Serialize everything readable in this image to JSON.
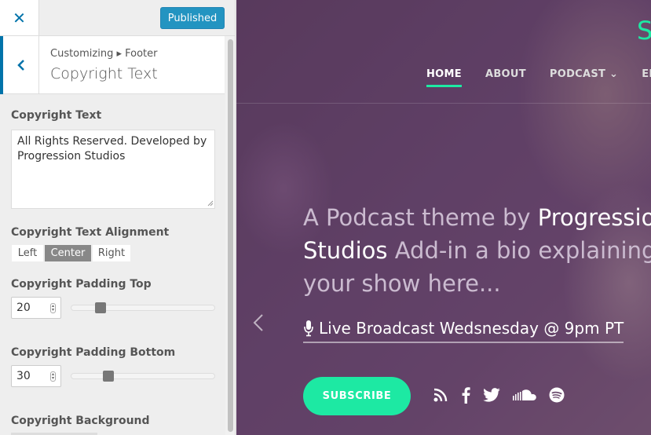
{
  "sidebar": {
    "close_label": "✕",
    "publish_label": "Published",
    "breadcrumb": "Customizing ▸ Footer",
    "section_title": "Copyright Text",
    "controls": {
      "copyright_text": {
        "label": "Copyright Text",
        "value": "All Rights Reserved. Developed by Progression Studios"
      },
      "alignment": {
        "label": "Copyright Text Alignment",
        "options": [
          "Left",
          "Center",
          "Right"
        ],
        "selected": "Center"
      },
      "padding_top": {
        "label": "Copyright Padding Top",
        "value": "20",
        "slider_fraction": 0.18
      },
      "padding_bottom": {
        "label": "Copyright Padding Bottom",
        "value": "30",
        "slider_fraction": 0.24
      },
      "background": {
        "label": "Copyright Background"
      }
    }
  },
  "preview": {
    "brand_letter": "S",
    "nav": [
      {
        "label": "HOME",
        "active": true
      },
      {
        "label": "ABOUT"
      },
      {
        "label": "PODCAST ⌄"
      },
      {
        "label": "EPISO"
      }
    ],
    "hero": {
      "part1": "A Podcast theme by ",
      "part2": "Progression Studios",
      "part3": " Add-in a bio explaining your show here..."
    },
    "broadcast": "Live Broadcast Wedsnesday @ 9pm PT",
    "subscribe_label": "SUBSCRIBE",
    "social_icons": [
      "rss-icon",
      "facebook-icon",
      "twitter-icon",
      "soundcloud-icon",
      "spotify-icon"
    ]
  },
  "colors": {
    "accent_blue": "#0073aa",
    "accent_green": "#1de9a3"
  }
}
